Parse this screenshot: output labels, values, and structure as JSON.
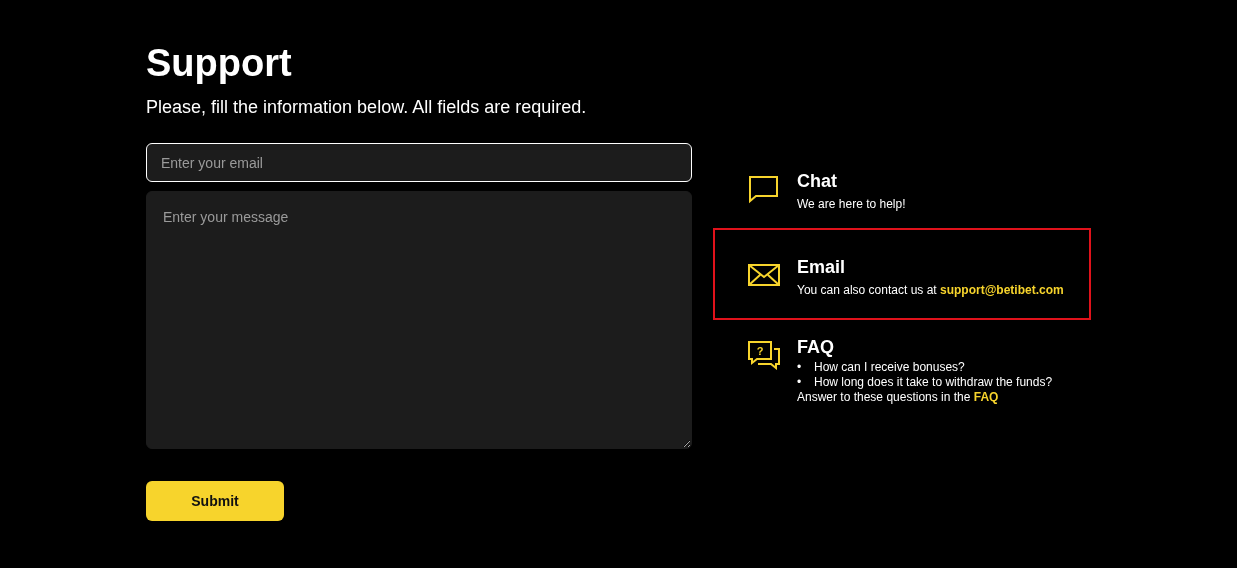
{
  "title": "Support",
  "subtitle": "Please, fill the information below. All fields are required.",
  "form": {
    "email": {
      "placeholder": "Enter your email",
      "focused": true
    },
    "message": {
      "placeholder": "Enter your message",
      "focused": false
    },
    "submit": "Submit"
  },
  "contacts": [
    {
      "kind": "chat",
      "title": "Chat",
      "highlighted": false,
      "text": "We are here to help!"
    },
    {
      "kind": "email",
      "title": "Email",
      "highlighted": true,
      "text": "You can also contact us at",
      "link": "support@betibet.com"
    },
    {
      "kind": "faq",
      "title": "FAQ",
      "highlighted": false,
      "icon_mark": "?",
      "bullet": "•",
      "questions": [
        "How can I receive bonuses?",
        "How long does it take to withdraw the funds?"
      ],
      "text": "Answer to these questions in the",
      "link": "FAQ"
    }
  ]
}
